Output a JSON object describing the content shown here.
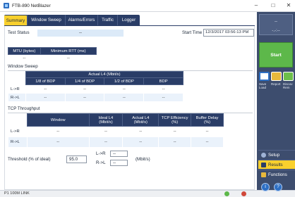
{
  "window": {
    "title": "FTB-890 NetBlazer",
    "minimize": "–",
    "maximize": "□",
    "close": "✕"
  },
  "tabs": [
    "Summary",
    "Window Sweep",
    "Alarms/Errors",
    "Traffic",
    "Logger"
  ],
  "summary": {
    "test_status_label": "Test Status",
    "test_status_value": "--",
    "start_time_label": "Start Time",
    "start_time_value": "12/3/2017 03:56:13 PM",
    "mtu_header": "MTU (bytes)",
    "min_rtt_header": "Minimum RTT (ms)",
    "mtu_value": "--",
    "min_rtt_value": "--"
  },
  "window_sweep": {
    "title": "Window Sweep",
    "group_header": "Actual L4 (Mbit/s)",
    "columns": [
      "1/8 of BDP",
      "1/4 of BDP",
      "1/2 of BDP",
      "BDP"
    ],
    "rows": [
      {
        "label": "L->R",
        "values": [
          "--",
          "--",
          "--",
          "--"
        ]
      },
      {
        "label": "R->L",
        "values": [
          "--",
          "--",
          "--",
          "--"
        ]
      }
    ]
  },
  "tcp_throughput": {
    "title": "TCP Throughput",
    "columns": [
      "Window",
      "Ideal L4\n(Mbit/s)",
      "Actual L4\n(Mbit/s)",
      "TCP Efficiency\n(%)",
      "Buffer Delay\n(%)"
    ],
    "rows": [
      {
        "label": "L->R",
        "values": [
          "--",
          "--",
          "--",
          "--",
          "--"
        ]
      },
      {
        "label": "R->L",
        "values": [
          "--",
          "--",
          "--",
          "--",
          "--"
        ]
      }
    ]
  },
  "threshold": {
    "label": "Threshold (% of ideal)",
    "value": "95.0",
    "lr_label": "L->R",
    "rl_label": "R->L",
    "lr_value": "--",
    "rl_value": "--",
    "unit": "(Mbit/s)"
  },
  "status_bar": {
    "left_text": "P1 100M LINK"
  },
  "dock": {
    "top_dash_1": "--",
    "top_dash_2": "-.-:--",
    "start": "Start",
    "tools": [
      "Save Load",
      "Report",
      "Discov Rem"
    ],
    "nav": [
      "Setup",
      "Results",
      "Functions"
    ],
    "round_buttons": [
      "i",
      "?"
    ],
    "colors": {
      "start": "#5db84a",
      "active_nav": "#f9d02d",
      "header": "#2a3d67"
    }
  }
}
